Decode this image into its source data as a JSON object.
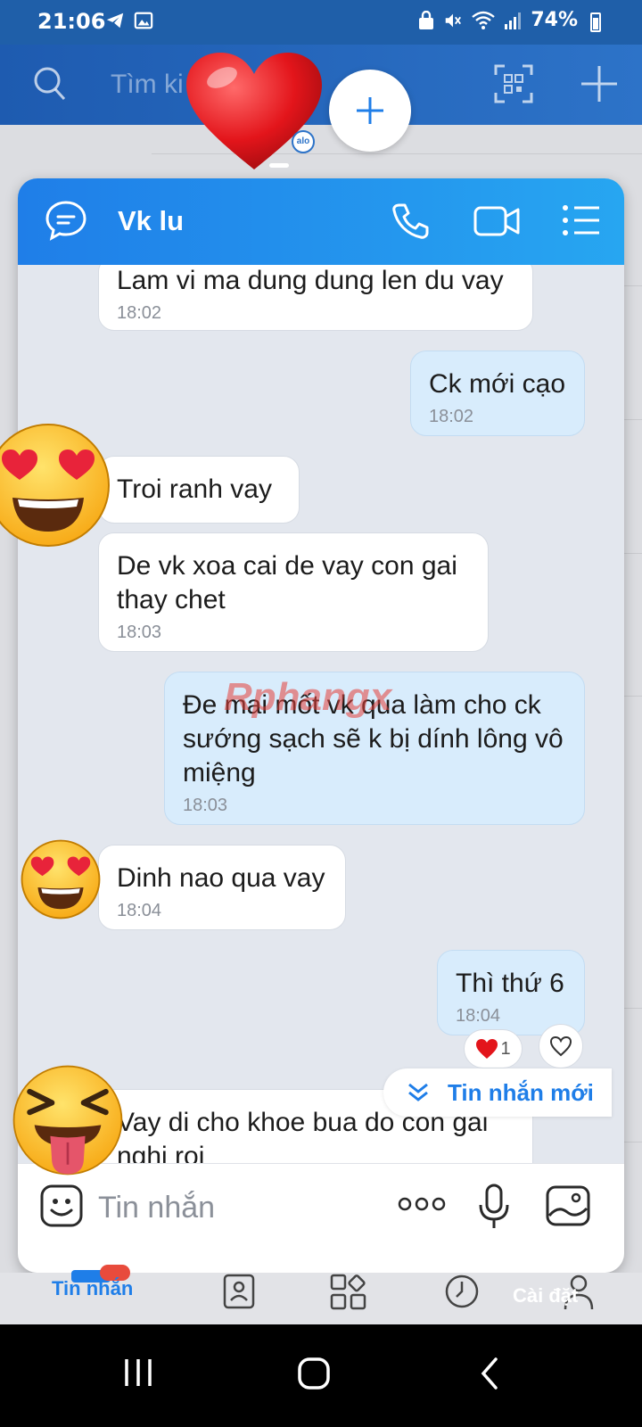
{
  "status_bar": {
    "time": "21:06",
    "battery": "74%"
  },
  "header": {
    "search_placeholder": "Tìm ki"
  },
  "floating": {
    "small_badge": "alo"
  },
  "chat": {
    "contact_name": "Vk lu",
    "messages": [
      {
        "direction": "received",
        "text": "Lam vi ma dung dung len du vay",
        "time": "18:02"
      },
      {
        "direction": "sent",
        "text": "Ck mới cạo",
        "time": "18:02"
      },
      {
        "direction": "received",
        "text": "Troi ranh vay",
        "time": ""
      },
      {
        "direction": "received",
        "text": "De vk xoa cai de vay con gai\nthay chet",
        "time": "18:03"
      },
      {
        "direction": "sent",
        "text": "Đe mai mốt vk qua làm cho ck\nsướng sạch sẽ k bị dính lông vô\nmiệng",
        "time": "18:03"
      },
      {
        "direction": "received",
        "text": "Dinh nao qua vay",
        "time": "18:04"
      },
      {
        "direction": "sent",
        "text": "Thì thứ 6",
        "time": "18:04"
      },
      {
        "direction": "received",
        "text": "Vay di cho khoe bua do con gai\nnghi roi",
        "time": ""
      }
    ],
    "reaction_count": "1",
    "new_messages_label": "Tin nhắn mới",
    "composer_placeholder": "Tin nhắn"
  },
  "tabs": {
    "messages_label": "Tin nhắn",
    "settings_label": "Cài đặt"
  },
  "colors": {
    "accent": "#1f7ee8",
    "sent_bubble": "#d8ecfc",
    "received_bubble": "#ffffff"
  }
}
